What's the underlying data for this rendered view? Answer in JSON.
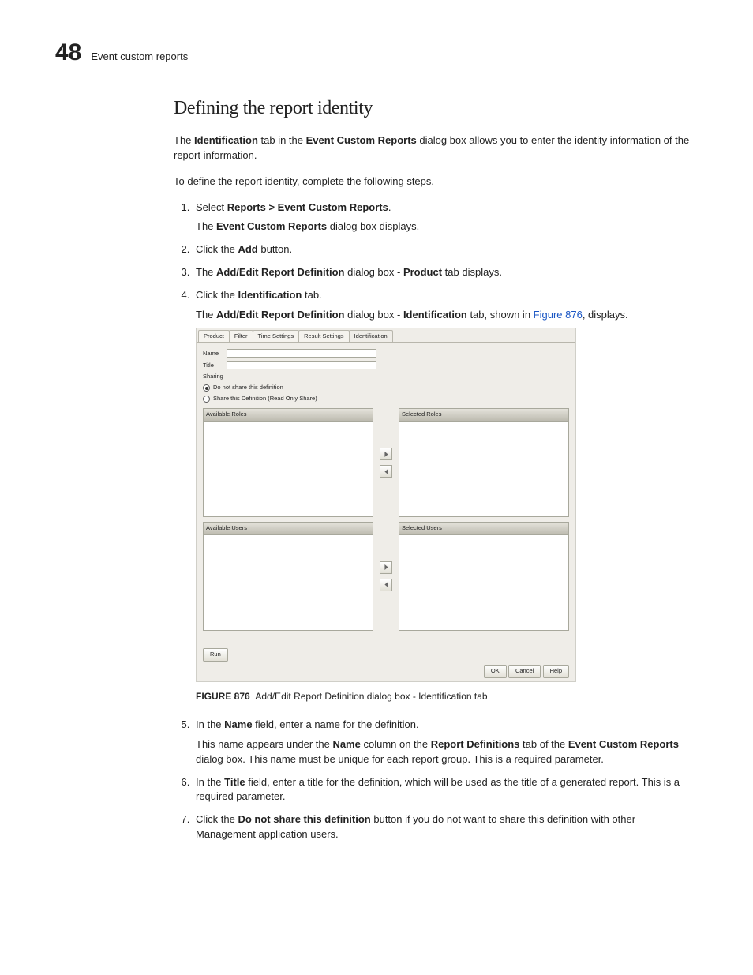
{
  "header": {
    "chapter_number": "48",
    "section_name": "Event custom reports"
  },
  "section_title": "Defining the report identity",
  "intro": {
    "p1_a": "The ",
    "p1_b": "Identification",
    "p1_c": " tab in the ",
    "p1_d": "Event Custom Reports",
    "p1_e": " dialog box allows you to enter the identity information of the report information.",
    "p2": "To define the report identity, complete the following steps."
  },
  "steps": {
    "s1_a": "Select ",
    "s1_b": "Reports > Event Custom Reports",
    "s1_c": ".",
    "s1_sub_a": "The ",
    "s1_sub_b": "Event Custom Reports",
    "s1_sub_c": " dialog box displays.",
    "s2_a": "Click the ",
    "s2_b": "Add",
    "s2_c": " button.",
    "s3_a": "The ",
    "s3_b": "Add/Edit Report Definition",
    "s3_c": " dialog box - ",
    "s3_d": "Product",
    "s3_e": " tab displays.",
    "s4_a": "Click the ",
    "s4_b": "Identification",
    "s4_c": " tab.",
    "s4_sub_a": "The ",
    "s4_sub_b": "Add/Edit Report Definition",
    "s4_sub_c": " dialog box - ",
    "s4_sub_d": "Identification",
    "s4_sub_e": " tab, shown in ",
    "s4_link": "Figure 876",
    "s4_sub_f": ", displays."
  },
  "dialog": {
    "tabs": [
      "Product",
      "Filter",
      "Time Settings",
      "Result Settings",
      "Identification"
    ],
    "labels": {
      "name": "Name",
      "title": "Title",
      "sharing": "Sharing",
      "opt_noshare": "Do not share this definition",
      "opt_share_ro": "Share this Definition (Read Only Share)",
      "avail_roles": "Available Roles",
      "sel_roles": "Selected Roles",
      "avail_users": "Available Users",
      "sel_users": "Selected Users",
      "run": "Run",
      "ok": "OK",
      "cancel": "Cancel",
      "help": "Help"
    },
    "name_value": "",
    "title_value": ""
  },
  "caption": {
    "lead": "FIGURE 876",
    "text": "Add/Edit Report Definition dialog box - Identification tab"
  },
  "steps2": {
    "s5_a": "In the ",
    "s5_b": "Name",
    "s5_c": " field, enter a name for the definition.",
    "s5_sub_a": "This name appears under the ",
    "s5_sub_b": "Name",
    "s5_sub_c": " column on the ",
    "s5_sub_d": "Report Definitions",
    "s5_sub_e": " tab of the ",
    "s5_sub_f": "Event Custom Reports",
    "s5_sub_g": " dialog box. This name must be unique for each report group. This is a required parameter.",
    "s6_a": "In the ",
    "s6_b": "Title",
    "s6_c": " field, enter a title for the definition, which will be used as the title of a generated report. This is a required parameter.",
    "s7_a": "Click the ",
    "s7_b": "Do not share this definition",
    "s7_c": " button if you do not want to share this definition with other Management application users."
  }
}
